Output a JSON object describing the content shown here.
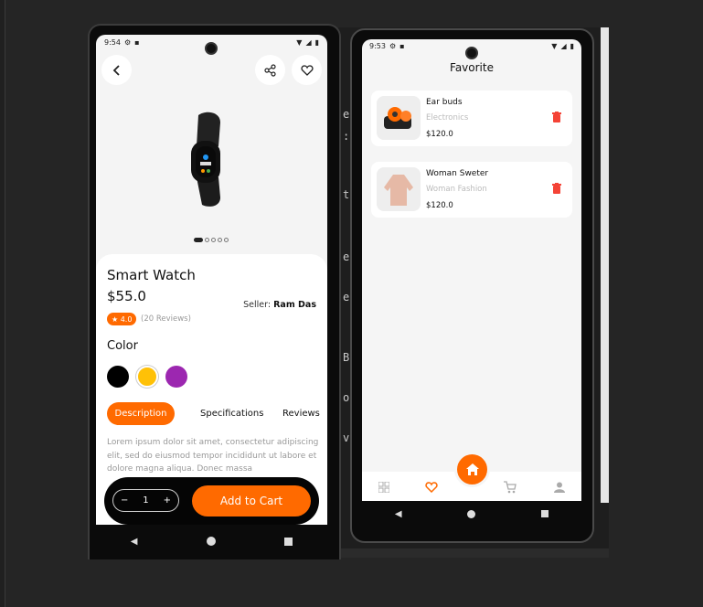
{
  "colors": {
    "accent": "#ff6a00",
    "delete": "#f44336",
    "yellow": "#ffc107",
    "purple": "#9c27b0",
    "black": "#000000"
  },
  "editor_chars": [
    "e",
    ":",
    "t",
    "e",
    "e",
    "B",
    "o",
    "v"
  ],
  "phone1": {
    "status_time": "9:54",
    "product_name": "Smart Watch",
    "price": "$55.0",
    "seller_label": "Seller:",
    "seller_name": "Ram Das",
    "rating": "★ 4.0",
    "reviews": "(20 Reviews)",
    "color_heading": "Color",
    "tabs": [
      "Description",
      "Specifications",
      "Reviews"
    ],
    "description": "Lorem ipsum dolor sit amet, consectetur adipiscing elit, sed do eiusmod tempor incididunt ut labore et dolore magna aliqua. Donec massa",
    "qty_minus": "−",
    "qty_value": "1",
    "qty_plus": "+",
    "add_to_cart": "Add to Cart"
  },
  "phone2": {
    "status_time": "9:53",
    "title": "Favorite",
    "items": [
      {
        "name": "Ear buds",
        "category": "Electronics",
        "price": "$120.0"
      },
      {
        "name": "Woman Sweter",
        "category": "Woman Fashion",
        "price": "$120.0"
      }
    ]
  }
}
